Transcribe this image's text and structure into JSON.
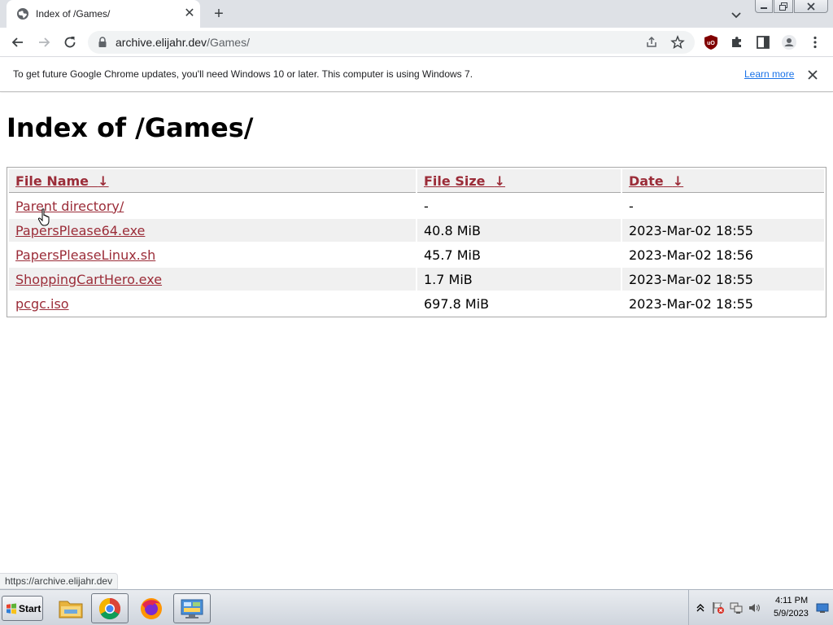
{
  "tab": {
    "title": "Index of /Games/",
    "close_glyph": "✕",
    "new_tab_glyph": "+"
  },
  "toolbar": {
    "url_host": "archive.elijahr.dev",
    "url_path": "/Games/"
  },
  "infobar": {
    "message": "To get future Google Chrome updates, you'll need Windows 10 or later. This computer is using Windows 7.",
    "link_label": "Learn more"
  },
  "page": {
    "title": "Index of /Games/",
    "columns": [
      {
        "label": "File Name",
        "sort_glyph": "↓"
      },
      {
        "label": "File Size",
        "sort_glyph": "↓"
      },
      {
        "label": "Date",
        "sort_glyph": "↓"
      }
    ],
    "rows": [
      {
        "name": "Parent directory/",
        "size": "-",
        "date": "-"
      },
      {
        "name": "PapersPlease64.exe",
        "size": "40.8 MiB",
        "date": "2023-Mar-02 18:55"
      },
      {
        "name": "PapersPleaseLinux.sh",
        "size": "45.7 MiB",
        "date": "2023-Mar-02 18:56"
      },
      {
        "name": "ShoppingCartHero.exe",
        "size": "1.7 MiB",
        "date": "2023-Mar-02 18:55"
      },
      {
        "name": "pcgc.iso",
        "size": "697.8 MiB",
        "date": "2023-Mar-02 18:55"
      }
    ]
  },
  "status_bubble": "https://archive.elijahr.dev",
  "taskbar": {
    "start_label": "Start",
    "apps": [
      "folder-icon",
      "chrome-icon",
      "firefox-icon",
      "control-panel-icon"
    ],
    "clock_time": "4:11 PM",
    "clock_date": "5/9/2023"
  },
  "colors": {
    "link": "#9b2c38",
    "header_bg": "#f0f0f0",
    "infobar_link": "#1a73e8",
    "tabstrip_bg": "#dee1e6"
  }
}
